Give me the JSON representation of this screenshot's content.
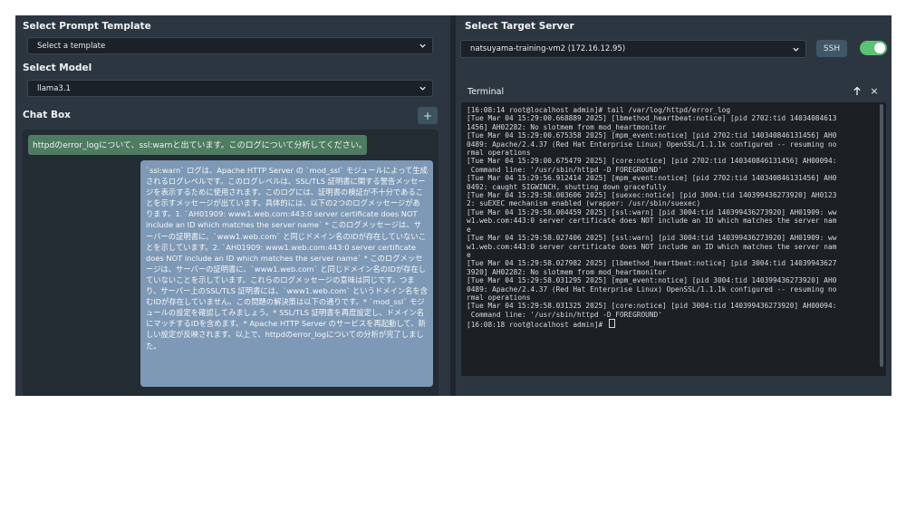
{
  "left_panel": {
    "prompt_template_label": "Select Prompt Template",
    "prompt_template_value": "Select a template",
    "model_label": "Select Model",
    "model_value": "llama3.1",
    "chat_box_label": "Chat Box",
    "add_button_label": "+"
  },
  "chat": {
    "user_message": "httpdのerror_logについて、ssl:warnと出ています。このログについて分析してください。",
    "assistant_message": "`ssl:warn` ログは、Apache HTTP Server の `mod_ssl` モジュールによって生成されるログレベルです。このログレベルは、SSL/TLS 証明書に関する警告メッセージを表示するために使用されます。このログには、証明書の検証が不十分であることを示すメッセージが出ています。具体的には、以下の2つのログメッセージがあります。1. `AH01909: www1.web.com:443:0 server certificate does NOT include an ID which matches the server name` * このログメッセージは、サーバーの証明書に、`www1.web.com` と同じドメイン名のIDが存在していないことを示しています。2. `AH01909: www1.web.com:443:0 server certificate does NOT include an ID which matches the server name` * このログメッセージは、サーバーの証明書に、`www1.web.com` と同じドメイン名のIDが存在していないことを示しています。これらのログメッセージの意味は同じです。つまり、サーバー上のSSL/TLS 証明書には、`www1.web.com` というドメイン名を含むIDが存在していません。この問題の解決策は以下の通りです。* `mod_ssl` モジュールの設定を確認してみましょう。* SSL/TLS 証明書を再度設定し、ドメイン名にマッチするIDを含めます。* Apache HTTP Server のサービスを再起動して、新しい設定が反映されます。以上で、httpdのerror_logについての分析が完了しました。"
  },
  "right_panel": {
    "target_server_label": "Select Target Server",
    "target_server_value": "natsuyama-training-vm2 (172.16.12.95)",
    "ssh_button_label": "SSH",
    "terminal_title": "Terminal",
    "close_label": "×"
  },
  "terminal": {
    "lines": [
      "[16:08:14 root@localhost admin]# tail /var/log/httpd/error_log",
      "[Tue Mar 04 15:29:00.668889 2025] [lbmethod_heartbeat:notice] [pid 2702:tid 14034084613",
      "1456] AH02282: No slotmem from mod_heartmonitor",
      "[Tue Mar 04 15:29:00.675358 2025] [mpm_event:notice] [pid 2702:tid 140340846131456] AH0",
      "0489: Apache/2.4.37 (Red Hat Enterprise Linux) OpenSSL/1.1.1k configured -- resuming no",
      "rmal operations",
      "[Tue Mar 04 15:29:00.675479 2025] [core:notice] [pid 2702:tid 140340846131456] AH00094:",
      " Command line: '/usr/sbin/httpd -D FOREGROUND'",
      "[Tue Mar 04 15:29:56.912414 2025] [mpm_event:notice] [pid 2702:tid 140340846131456] AH0",
      "0492: caught SIGWINCH, shutting down gracefully",
      "[Tue Mar 04 15:29:58.003606 2025] [suexec:notice] [pid 3004:tid 140399436273920] AH0123",
      "2: suEXEC mechanism enabled (wrapper: /usr/sbin/suexec)",
      "[Tue Mar 04 15:29:58.004459 2025] [ssl:warn] [pid 3004:tid 140399436273920] AH01909: ww",
      "w1.web.com:443:0 server certificate does NOT include an ID which matches the server nam",
      "e",
      "[Tue Mar 04 15:29:58.027406 2025] [ssl:warn] [pid 3004:tid 140399436273920] AH01909: ww",
      "w1.web.com:443:0 server certificate does NOT include an ID which matches the server nam",
      "e",
      "[Tue Mar 04 15:29:58.027982 2025] [lbmethod_heartbeat:notice] [pid 3004:tid 14039943627",
      "3920] AH02282: No slotmem from mod_heartmonitor",
      "[Tue Mar 04 15:29:58.031295 2025] [mpm_event:notice] [pid 3004:tid 140399436273920] AH0",
      "0489: Apache/2.4.37 (Red Hat Enterprise Linux) OpenSSL/1.1.1k configured -- resuming no",
      "rmal operations",
      "[Tue Mar 04 15:29:58.031325 2025] [core:notice] [pid 3004:tid 140399436273920] AH00094:",
      " Command line: '/usr/sbin/httpd -D FOREGROUND'",
      "[16:08:18 root@localhost admin]# "
    ]
  },
  "toggle": {
    "on": true
  },
  "icons": [
    "chevron-down-icon",
    "arrow-up-icon",
    "close-icon",
    "plus-icon"
  ],
  "colors": {
    "panel_bg": "#2c3641",
    "user_bubble": "#4e7b61",
    "assistant_bubble": "#7e99b5",
    "toggle_on": "#59c473",
    "terminal_bg": "#1c2025"
  }
}
